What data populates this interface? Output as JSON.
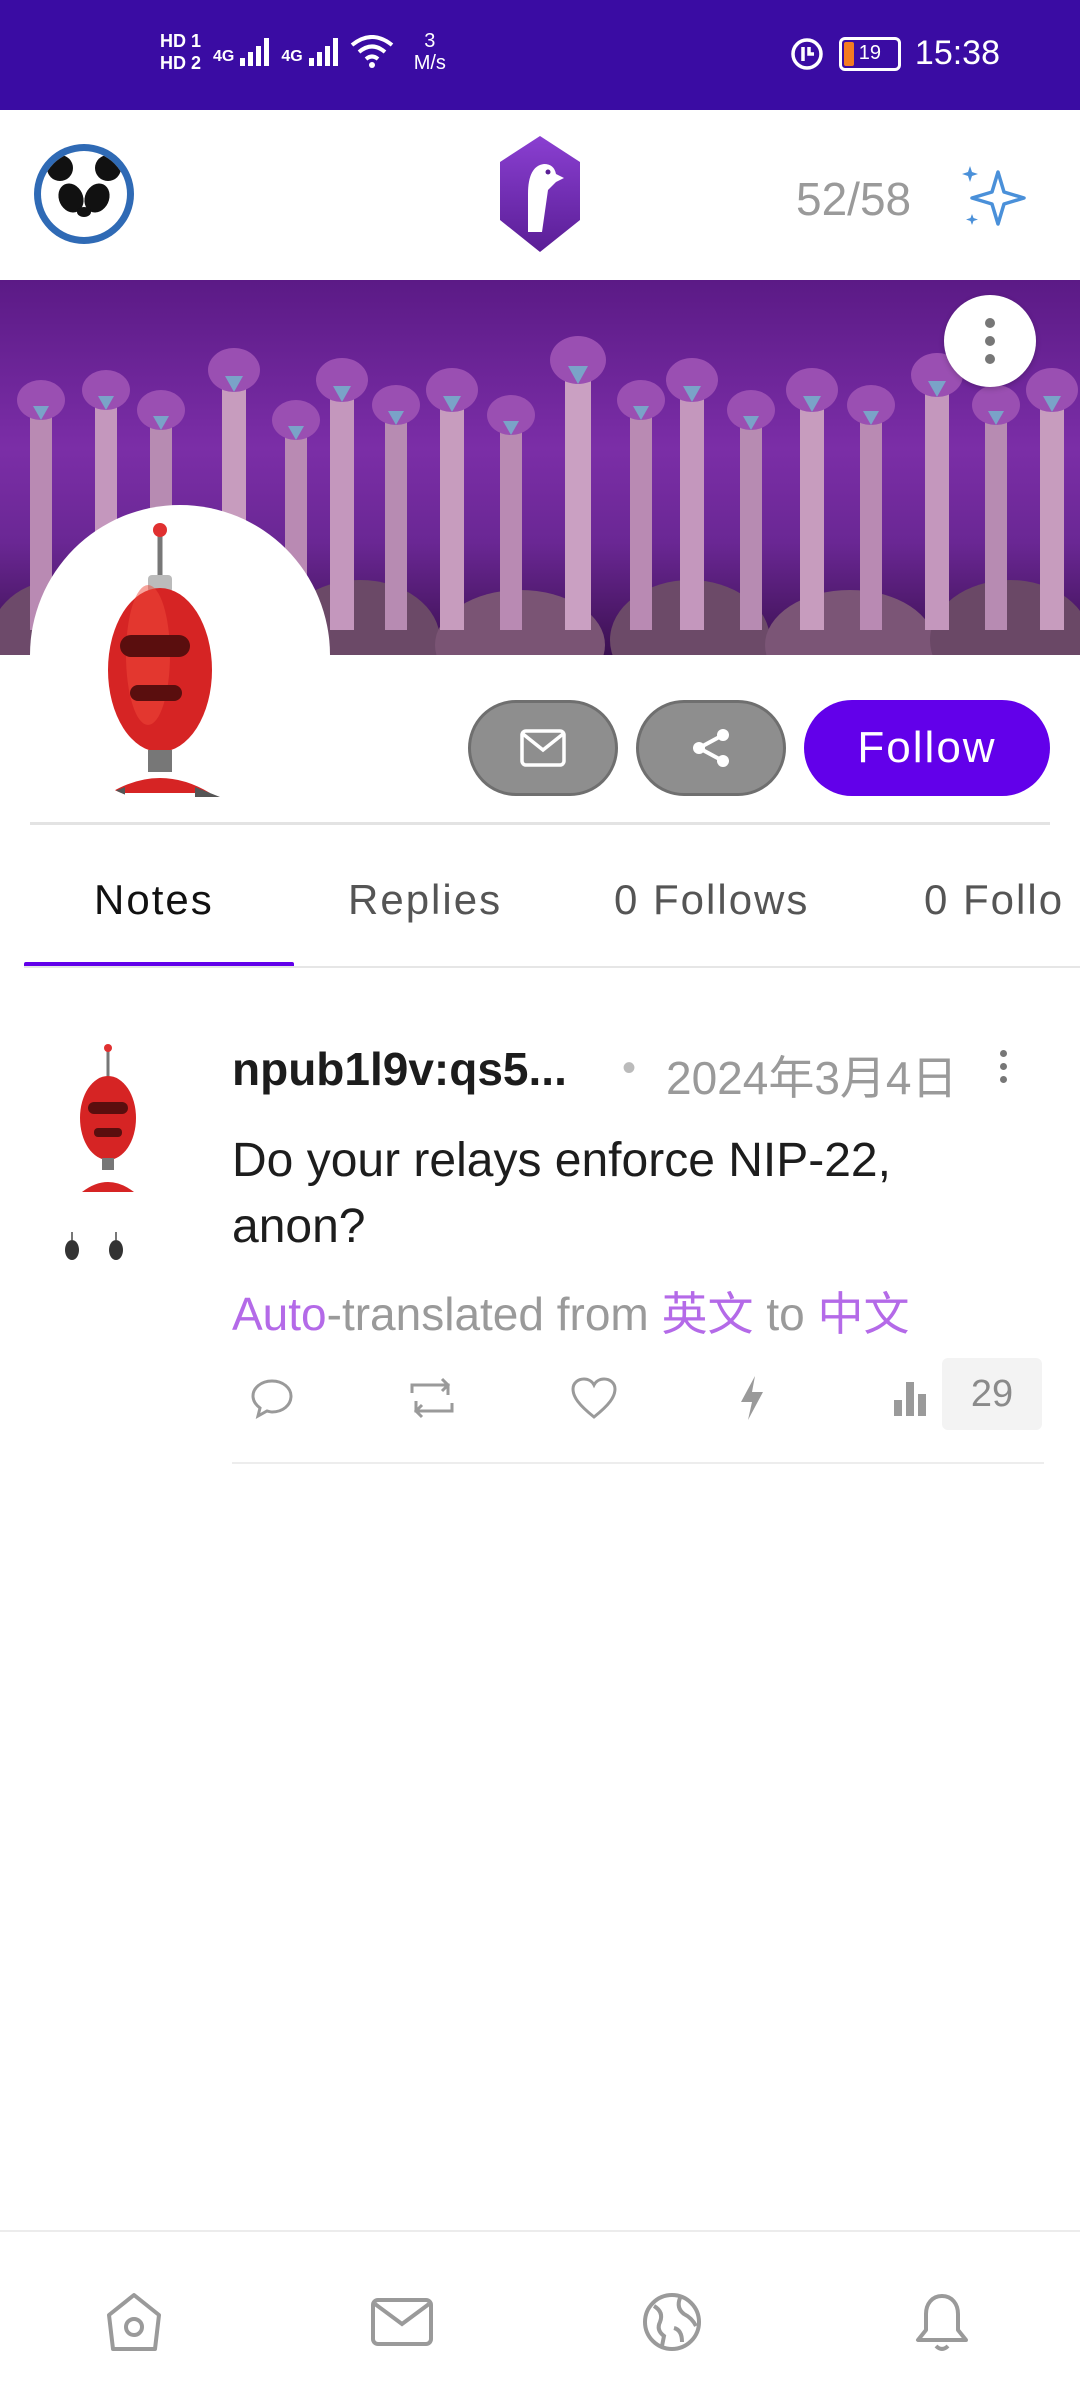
{
  "status_bar": {
    "hd1": "HD 1",
    "hd2": "HD 2",
    "net1": "4G",
    "net2": "4G",
    "speed_value": "3",
    "speed_unit": "M/s",
    "battery": "19",
    "time": "15:38"
  },
  "app_bar": {
    "counter": "52/58"
  },
  "actions": {
    "follow_label": "Follow"
  },
  "tabs": [
    {
      "label": "Notes"
    },
    {
      "label": "Replies"
    },
    {
      "label": "0 Follows"
    },
    {
      "label": "0  Follo"
    }
  ],
  "note": {
    "author": "npub1l9v:qs5...",
    "separator": "•",
    "date": "2024年3月4日",
    "text": "Do your relays enforce NIP-22, anon?",
    "translation": {
      "prefix": "Auto",
      "middle": "-translated from ",
      "from_lang": "英文",
      "to_word": " to ",
      "to_lang": "中文"
    },
    "views": "29"
  },
  "colors": {
    "accent": "#6200ea",
    "status_bar": "#3a0ca3",
    "translation_accent": "#b46ae8"
  },
  "icons": {
    "sparkle": "sparkle-icon",
    "mail": "mail-icon",
    "share": "share-icon",
    "reply": "reply-icon",
    "repost": "repost-icon",
    "like": "heart-icon",
    "zap": "zap-icon",
    "stats": "bar-chart-icon",
    "home": "home-icon",
    "messages": "mail-icon",
    "global": "globe-icon",
    "notifications": "bell-icon"
  }
}
